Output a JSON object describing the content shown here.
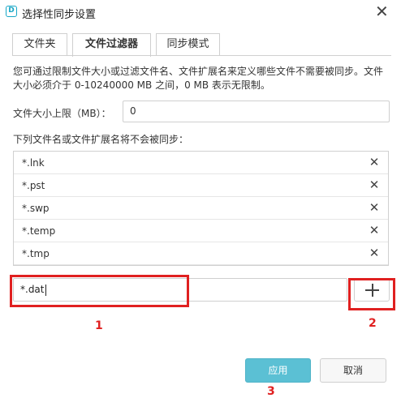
{
  "window": {
    "title": "选择性同步设置",
    "app_icon_letter": "D"
  },
  "tabs": [
    {
      "label": "文件夹",
      "active": false
    },
    {
      "label": "文件过滤器",
      "active": true
    },
    {
      "label": "同步模式",
      "active": false
    }
  ],
  "description": "您可通过限制文件大小或过滤文件名、文件扩展名来定义哪些文件不需要被同步。文件大小必须介于 0-10240000 MB 之间，0 MB 表示无限制。",
  "size_limit": {
    "label": "文件大小上限（MB）：",
    "value": "0"
  },
  "exclude_list": {
    "label": "下列文件名或文件扩展名将不会被同步：",
    "items": [
      "*.lnk",
      "*.pst",
      "*.swp",
      "*.temp",
      "*.tmp"
    ],
    "delete_icon": "close-icon"
  },
  "new_entry": {
    "value": "*.dat",
    "add_icon": "plus-icon"
  },
  "annotations": {
    "labels": [
      "1",
      "2",
      "3"
    ],
    "color": "#e02020"
  },
  "footer": {
    "apply_label": "应用",
    "cancel_label": "取消",
    "apply_color": "#5bc0d4"
  }
}
